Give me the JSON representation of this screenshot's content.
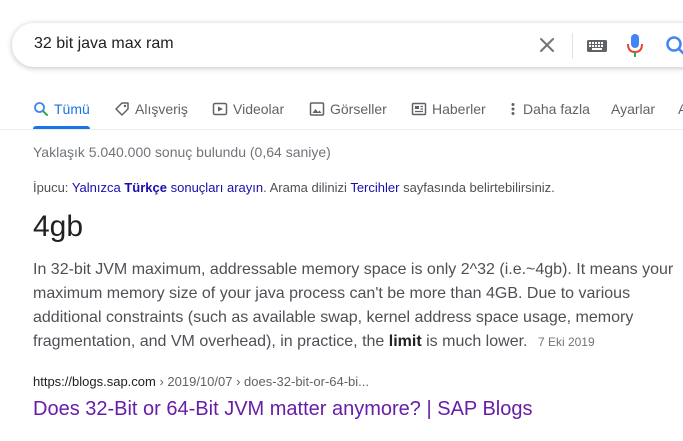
{
  "search": {
    "query": "32 bit java max ram"
  },
  "tabs": [
    {
      "label": "Tümü",
      "icon": "search-icon"
    },
    {
      "label": "Alışveriş",
      "icon": "tag-icon"
    },
    {
      "label": "Videolar",
      "icon": "play-icon"
    },
    {
      "label": "Görseller",
      "icon": "image-icon"
    },
    {
      "label": "Haberler",
      "icon": "news-icon"
    },
    {
      "label": "Daha fazla",
      "icon": "more-vert-icon"
    },
    {
      "label": "Ayarlar"
    },
    {
      "label": "A"
    }
  ],
  "results_stats": "Yaklaşık 5.040.000 sonuç bulundu (0,64 saniye)",
  "tip": {
    "prefix": "İpucu:",
    "link1_a": "Yalnızca",
    "link1_b": "Türkçe",
    "link1_c": "sonuçları arayın",
    "middle": ". Arama dilinizi",
    "link2": "Tercihler",
    "suffix": "sayfasında belirtebilirsiniz."
  },
  "featured": {
    "answer": "4gb",
    "snippet_pre": "In 32-bit JVM maximum, addressable memory space is only 2^32 (i.e.~4gb). It means your maximum memory size of your java process can't be more than 4GB. Due to various additional constraints (such as available swap, kernel address space usage, memory fragmentation, and VM overhead), in practice, the",
    "snippet_bold": "limit",
    "snippet_post": "is much lower.",
    "date": "7 Eki 2019"
  },
  "result": {
    "site": "https://blogs.sap.com",
    "path": " › 2019/10/07 › does-32-bit-or-64-bi...",
    "title": "Does 32-Bit or 64-Bit JVM matter anymore? | SAP Blogs"
  },
  "colors": {
    "accent": "#1a73e8",
    "link": "#1a0dab",
    "visited": "#681da8",
    "mic_blue": "#4285f4",
    "mic_red": "#ea4335"
  }
}
